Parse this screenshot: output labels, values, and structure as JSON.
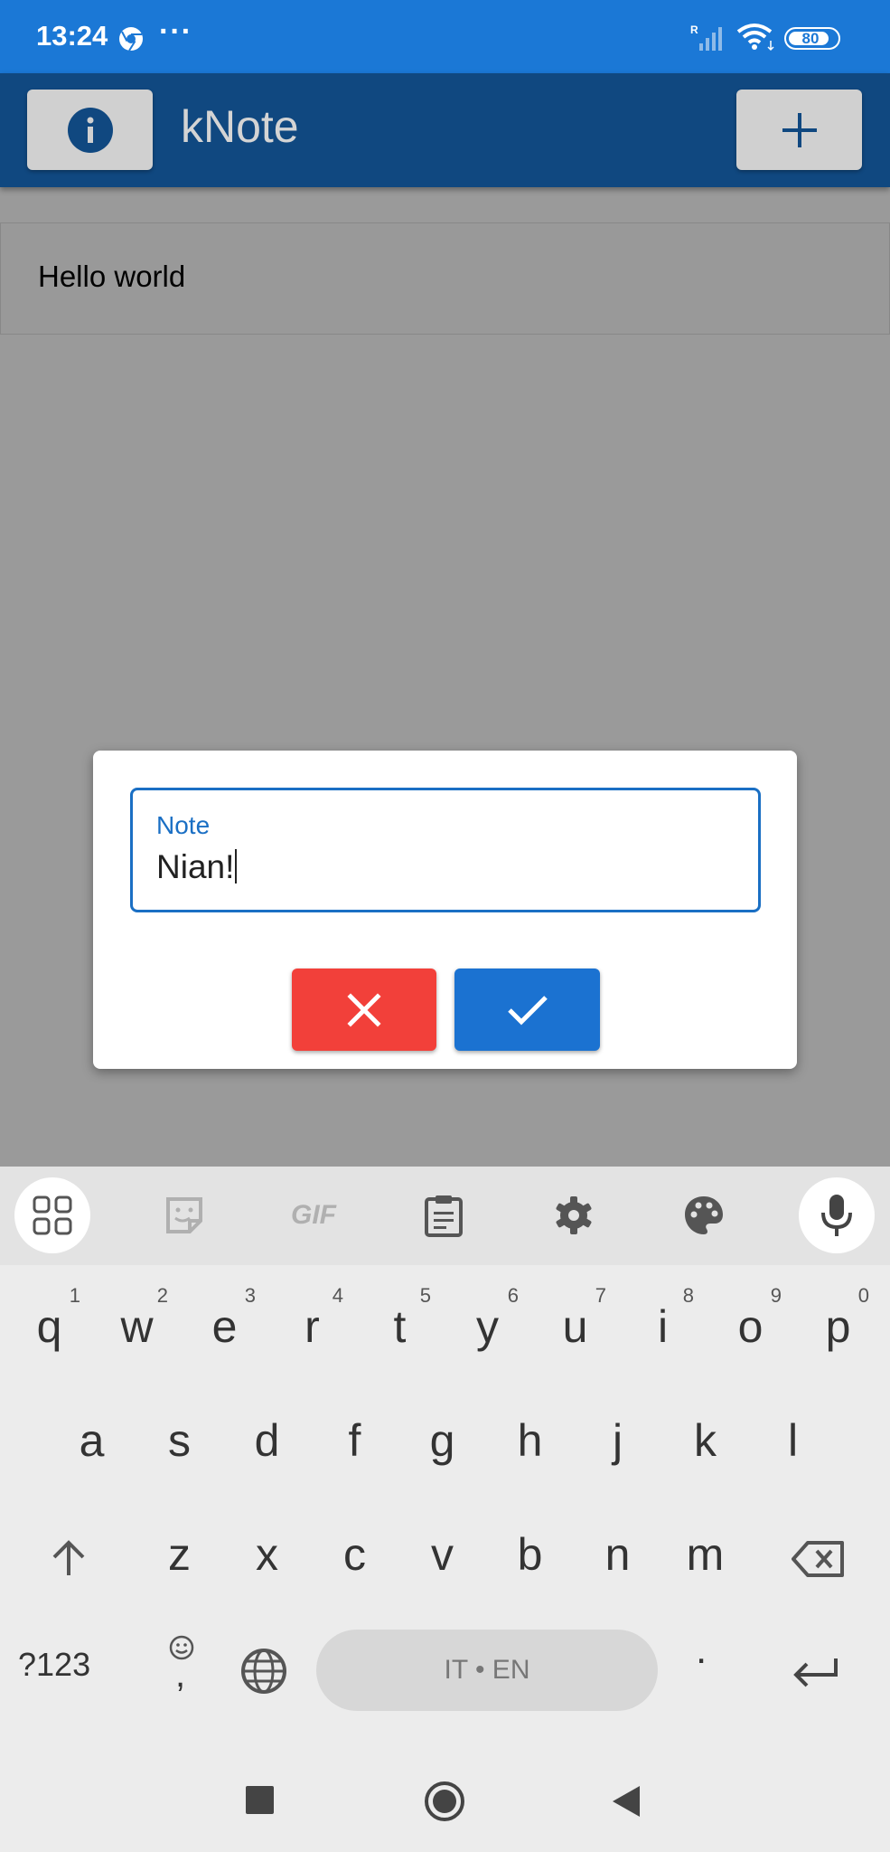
{
  "status_bar": {
    "time": "13:24",
    "more": "···",
    "battery": "80"
  },
  "app_bar": {
    "title": "kNote",
    "info_icon": "info-icon",
    "add_icon": "plus-icon"
  },
  "notes": [
    {
      "text": "Hello world"
    }
  ],
  "dialog": {
    "field_label": "Note",
    "field_value": "Nian!",
    "cancel_icon": "close-icon",
    "confirm_icon": "check-icon",
    "cancel_color": "#f2403a",
    "confirm_color": "#1b72d1"
  },
  "keyboard": {
    "toolbar": [
      "apps-icon",
      "sticker-icon",
      "gif-icon",
      "clipboard-icon",
      "settings-icon",
      "palette-icon",
      "mic-icon"
    ],
    "gif_label": "GIF",
    "row1": [
      {
        "key": "q",
        "hint": "1"
      },
      {
        "key": "w",
        "hint": "2"
      },
      {
        "key": "e",
        "hint": "3"
      },
      {
        "key": "r",
        "hint": "4"
      },
      {
        "key": "t",
        "hint": "5"
      },
      {
        "key": "y",
        "hint": "6"
      },
      {
        "key": "u",
        "hint": "7"
      },
      {
        "key": "i",
        "hint": "8"
      },
      {
        "key": "o",
        "hint": "9"
      },
      {
        "key": "p",
        "hint": "0"
      }
    ],
    "row2": [
      "a",
      "s",
      "d",
      "f",
      "g",
      "h",
      "j",
      "k",
      "l"
    ],
    "row3": [
      "z",
      "x",
      "c",
      "v",
      "b",
      "n",
      "m"
    ],
    "symbols_label": "?123",
    "space_label": "IT • EN",
    "period_label": ".",
    "comma_label": ","
  },
  "colors": {
    "status_bar": "#1b78d6",
    "app_bar": "#104880",
    "accent": "#1a6fc4"
  }
}
